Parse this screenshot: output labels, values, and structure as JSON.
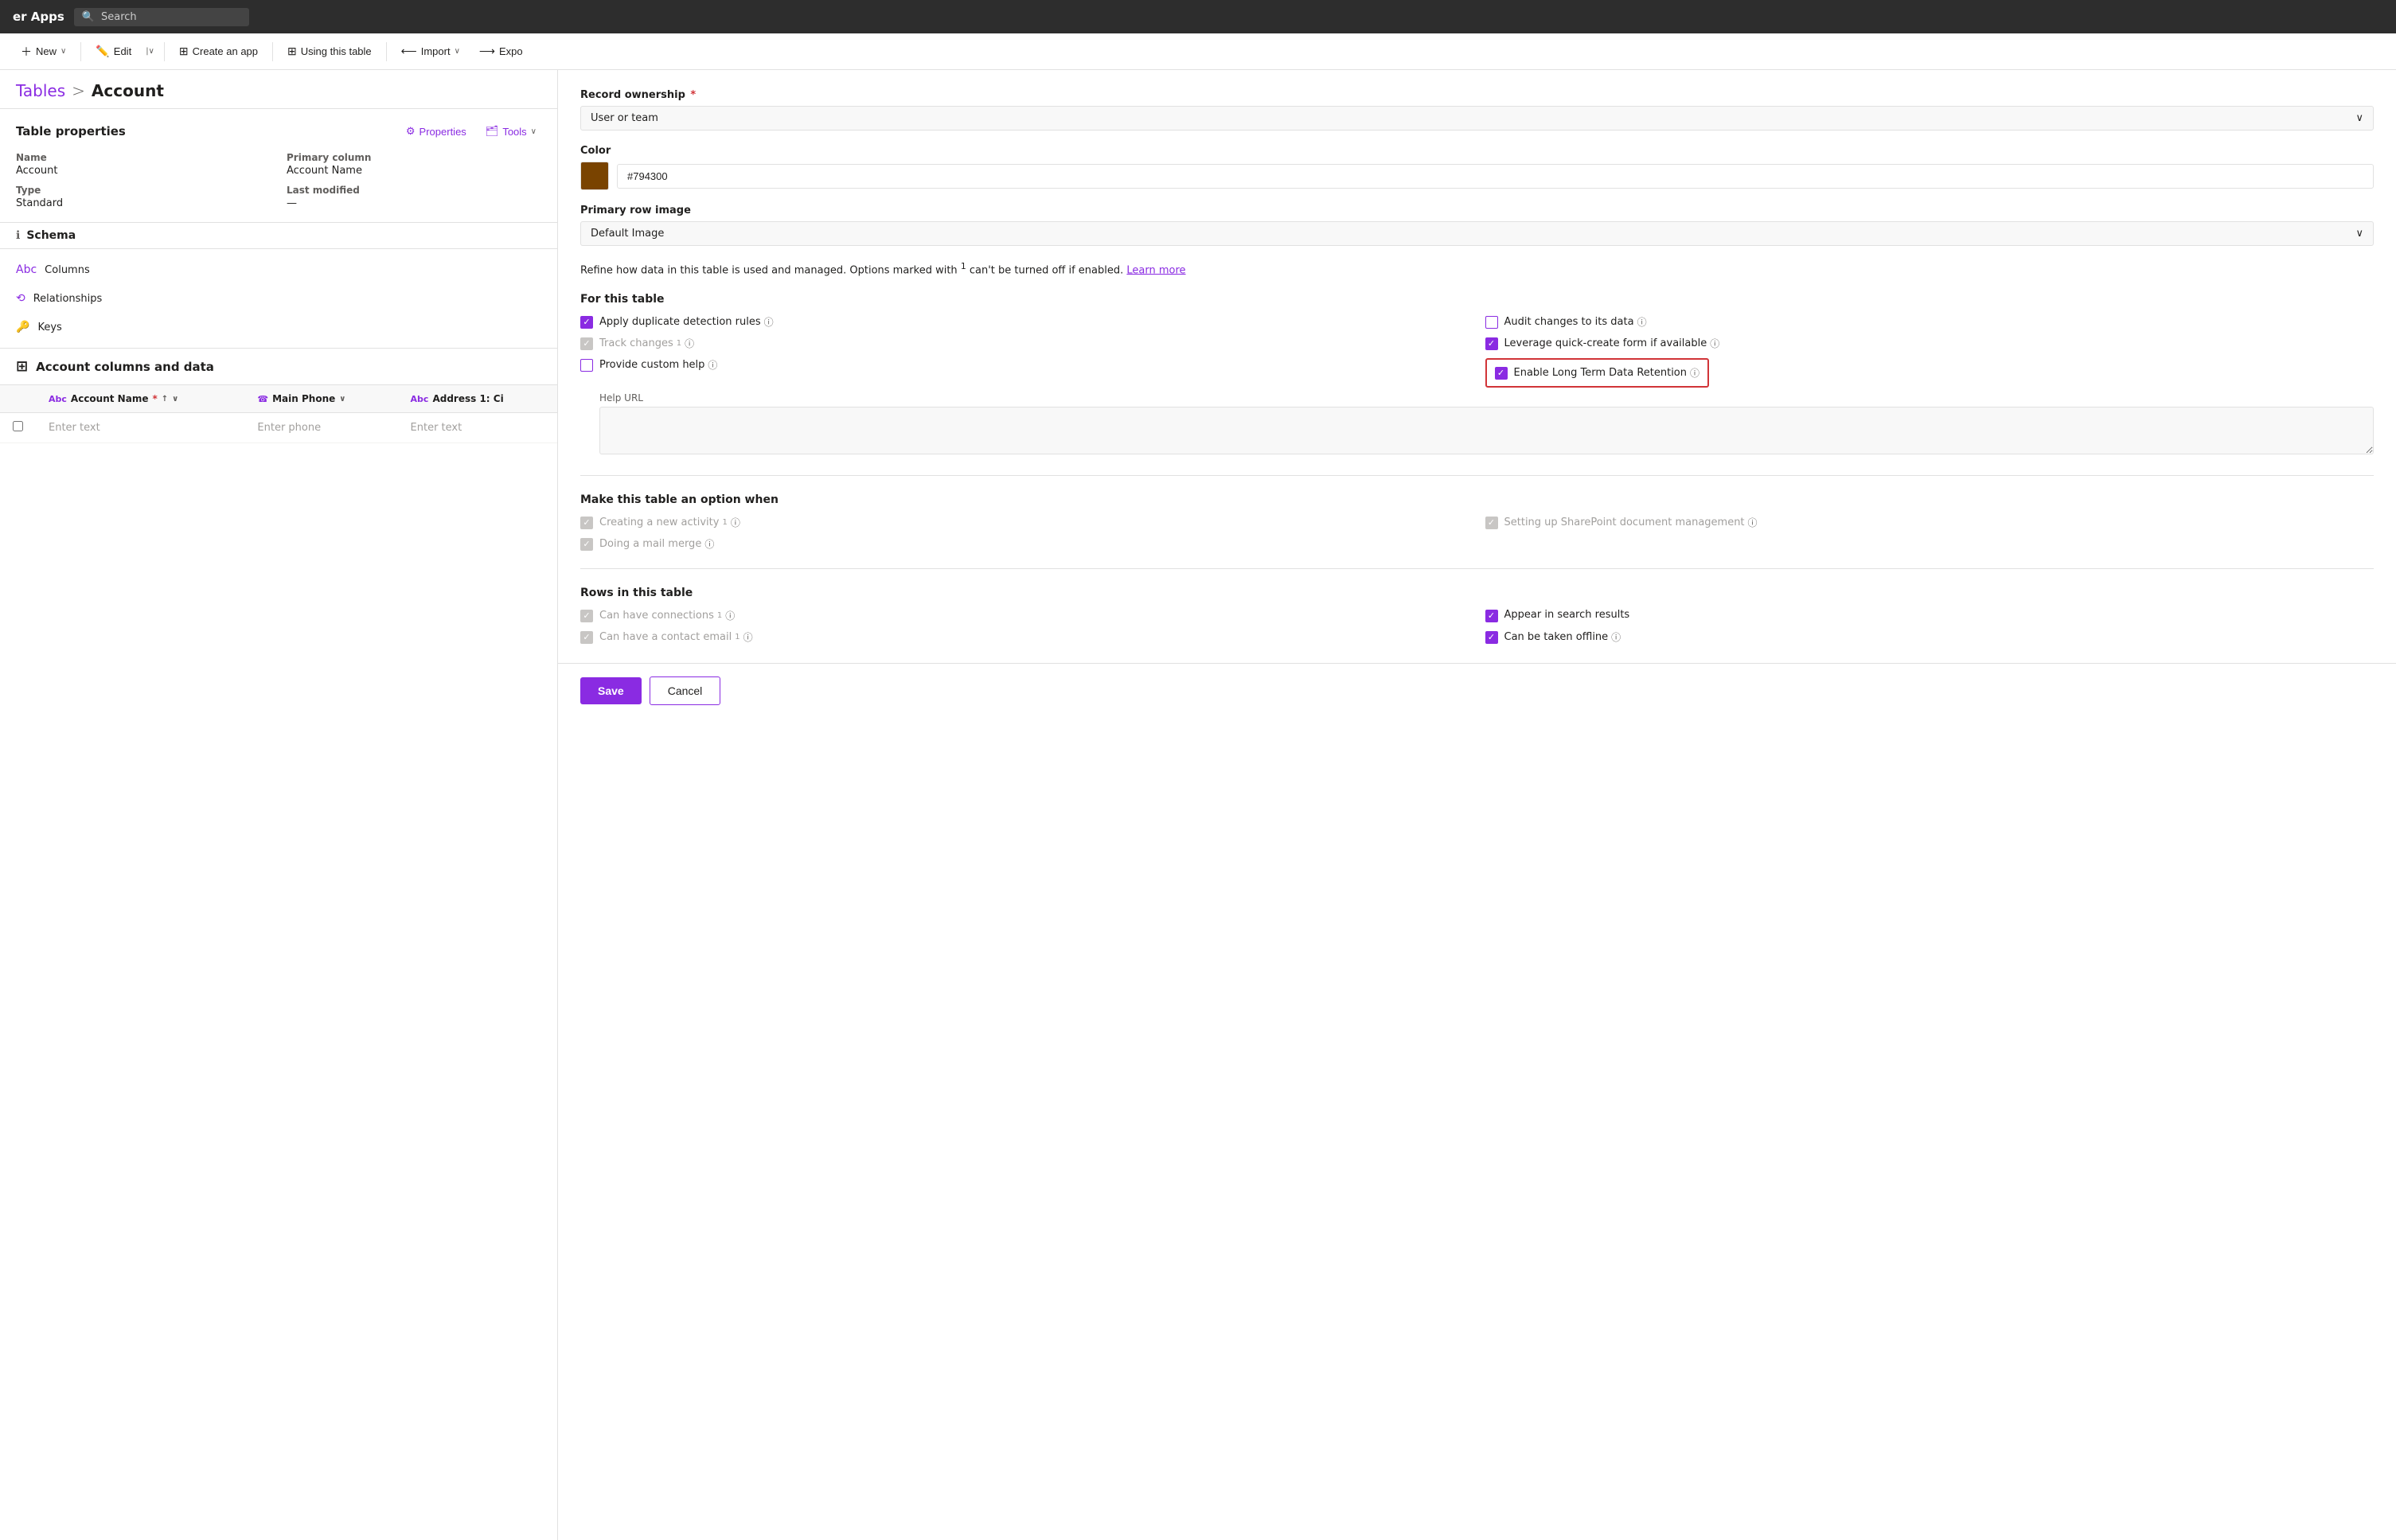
{
  "topbar": {
    "title": "er Apps",
    "search_placeholder": "Search"
  },
  "toolbar": {
    "new_label": "New",
    "edit_label": "Edit",
    "create_app_label": "Create an app",
    "using_table_label": "Using this table",
    "import_label": "Import",
    "export_label": "Expo"
  },
  "breadcrumb": {
    "tables": "Tables",
    "separator": ">",
    "current": "Account"
  },
  "table_properties": {
    "title": "Table properties",
    "properties_btn": "Properties",
    "tools_btn": "Tools",
    "name_label": "Name",
    "name_value": "Account",
    "primary_column_label": "Primary column",
    "primary_column_value": "Account Name",
    "type_label": "Type",
    "type_value": "Standard",
    "last_modified_label": "Last modified",
    "last_modified_value": "—"
  },
  "schema": {
    "label": "Schema",
    "columns_label": "Columns",
    "relationships_label": "Relationships",
    "keys_label": "Keys"
  },
  "columns_section": {
    "title": "Account columns and data",
    "columns": [
      {
        "type_icon": "Abc",
        "name": "Account Name",
        "required": true,
        "sort": "↑",
        "caret": "∨"
      },
      {
        "type_icon": "☎",
        "name": "Main Phone",
        "caret": "∨"
      },
      {
        "type_icon": "Abc",
        "name": "Address 1: Ci",
        "caret": ""
      }
    ],
    "placeholders": [
      "Enter text",
      "Enter phone",
      "Enter text"
    ]
  },
  "right_panel": {
    "record_ownership": {
      "label": "Record ownership",
      "required": true,
      "value": "User or team"
    },
    "color": {
      "label": "Color",
      "swatch": "#794300",
      "value": "#794300"
    },
    "primary_row_image": {
      "label": "Primary row image",
      "value": "Default Image"
    },
    "refine_text": "Refine how data in this table is used and managed. Options marked with ",
    "refine_superscript": "1",
    "refine_text2": " can't be turned off if enabled.",
    "learn_more": "Learn more",
    "for_this_table": {
      "title": "For this table",
      "checkboxes": [
        {
          "id": "apply_dup",
          "label": "Apply duplicate detection rules",
          "info": true,
          "checked": "checked",
          "disabled": false
        },
        {
          "id": "audit_changes",
          "label": "Audit changes to its data",
          "info": true,
          "checked": "unchecked",
          "disabled": false
        },
        {
          "id": "track_changes",
          "label": "Track changes",
          "superscript": "1",
          "info": true,
          "checked": "disabled-checked",
          "disabled": true
        },
        {
          "id": "leverage_quick",
          "label": "Leverage quick-create form if available",
          "info": true,
          "checked": "checked",
          "disabled": false
        },
        {
          "id": "provide_custom",
          "label": "Provide custom help",
          "info": true,
          "checked": "unchecked",
          "disabled": false
        },
        {
          "id": "enable_long",
          "label": "Enable Long Term Data Retention",
          "info": true,
          "checked": "checked",
          "disabled": false,
          "highlight": true
        }
      ],
      "help_url_label": "Help URL"
    },
    "make_option_when": {
      "title": "Make this table an option when",
      "checkboxes": [
        {
          "id": "creating_activity",
          "label": "Creating a new activity",
          "superscript": "1",
          "info": true,
          "checked": "disabled-checked",
          "disabled": true
        },
        {
          "id": "sharepoint",
          "label": "Setting up SharePoint document management",
          "info": true,
          "checked": "disabled-checked",
          "disabled": true
        },
        {
          "id": "mail_merge",
          "label": "Doing a mail merge",
          "info": true,
          "checked": "disabled-checked",
          "disabled": true
        }
      ]
    },
    "rows_in_table": {
      "title": "Rows in this table",
      "checkboxes": [
        {
          "id": "can_connections",
          "label": "Can have connections",
          "superscript": "1",
          "info": true,
          "checked": "disabled-checked",
          "disabled": true
        },
        {
          "id": "appear_search",
          "label": "Appear in search results",
          "info": true,
          "checked": "checked",
          "disabled": false
        },
        {
          "id": "contact_email",
          "label": "Can have a contact email",
          "superscript": "1",
          "info": true,
          "checked": "disabled-checked",
          "disabled": true
        },
        {
          "id": "taken_offline",
          "label": "Can be taken offline",
          "info": true,
          "checked": "checked",
          "disabled": false
        }
      ]
    },
    "save_label": "Save",
    "cancel_label": "Cancel"
  }
}
